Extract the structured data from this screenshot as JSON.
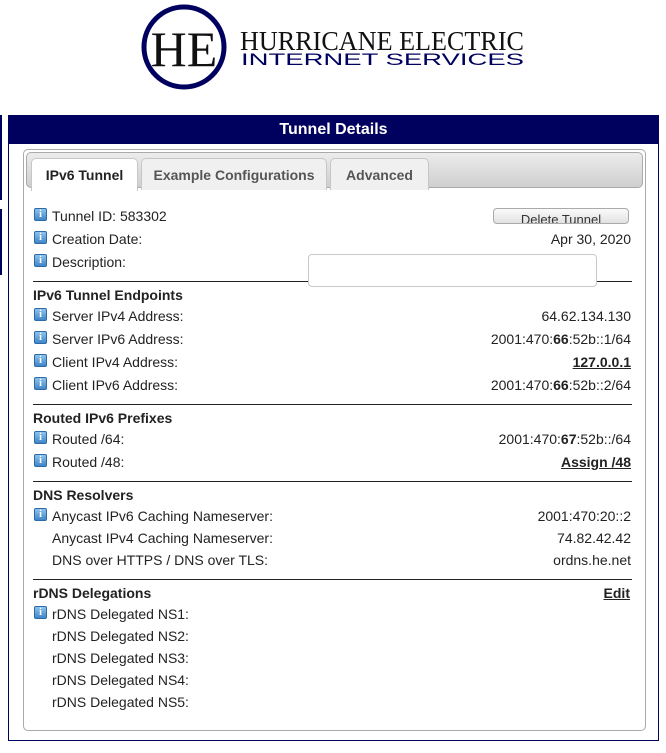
{
  "logo": {
    "monogram": "HE",
    "line1": "HURRICANE ELECTRIC",
    "line2": "INTERNET SERVICES",
    "brand_color": "#00005f"
  },
  "panel": {
    "title": "Tunnel Details",
    "header_color": "#00005f"
  },
  "tabs": [
    {
      "label": "IPv6 Tunnel",
      "active": true
    },
    {
      "label": "Example Configurations",
      "active": false
    },
    {
      "label": "Advanced",
      "active": false
    }
  ],
  "tunnel": {
    "id_label": "Tunnel ID: 583302",
    "delete_button": "Delete Tunnel",
    "creation_label": "Creation Date:",
    "creation_value": "Apr 30, 2020",
    "description_label": "Description:",
    "description_value": "",
    "description_placeholder": ""
  },
  "endpoints": {
    "title": "IPv6 Tunnel Endpoints",
    "rows": [
      {
        "label": "Server IPv4 Address:",
        "value": "64.62.134.130"
      },
      {
        "label": "Server IPv6 Address:",
        "value_pre": "2001:470:",
        "value_bold": "66",
        "value_post": ":52b::1/64"
      },
      {
        "label": "Client IPv4 Address:",
        "value": "127.0.0.1",
        "link": true
      },
      {
        "label": "Client IPv6 Address:",
        "value_pre": "2001:470:",
        "value_bold": "66",
        "value_post": ":52b::2/64"
      }
    ]
  },
  "prefixes": {
    "title": "Routed IPv6 Prefixes",
    "rows": [
      {
        "label": "Routed /64:",
        "value_pre": "2001:470:",
        "value_bold": "67",
        "value_post": ":52b::/64"
      },
      {
        "label": "Routed /48:",
        "value": "Assign /48",
        "link": true
      }
    ]
  },
  "dns": {
    "title": "DNS Resolvers",
    "rows": [
      {
        "label": "Anycast IPv6 Caching Nameserver:",
        "value": "2001:470:20::2",
        "info": true
      },
      {
        "label": "Anycast IPv4 Caching Nameserver:",
        "value": "74.82.42.42",
        "info": false
      },
      {
        "label": "DNS over HTTPS / DNS over TLS:",
        "value": "ordns.he.net",
        "info": false
      }
    ]
  },
  "rdns": {
    "title": "rDNS Delegations",
    "edit_link": "Edit",
    "rows": [
      {
        "label": "rDNS Delegated NS1:",
        "value": "",
        "info": true
      },
      {
        "label": "rDNS Delegated NS2:",
        "value": "",
        "info": false
      },
      {
        "label": "rDNS Delegated NS3:",
        "value": "",
        "info": false
      },
      {
        "label": "rDNS Delegated NS4:",
        "value": "",
        "info": false
      },
      {
        "label": "rDNS Delegated NS5:",
        "value": "",
        "info": false
      }
    ]
  },
  "icons": {
    "info": "info-icon"
  }
}
